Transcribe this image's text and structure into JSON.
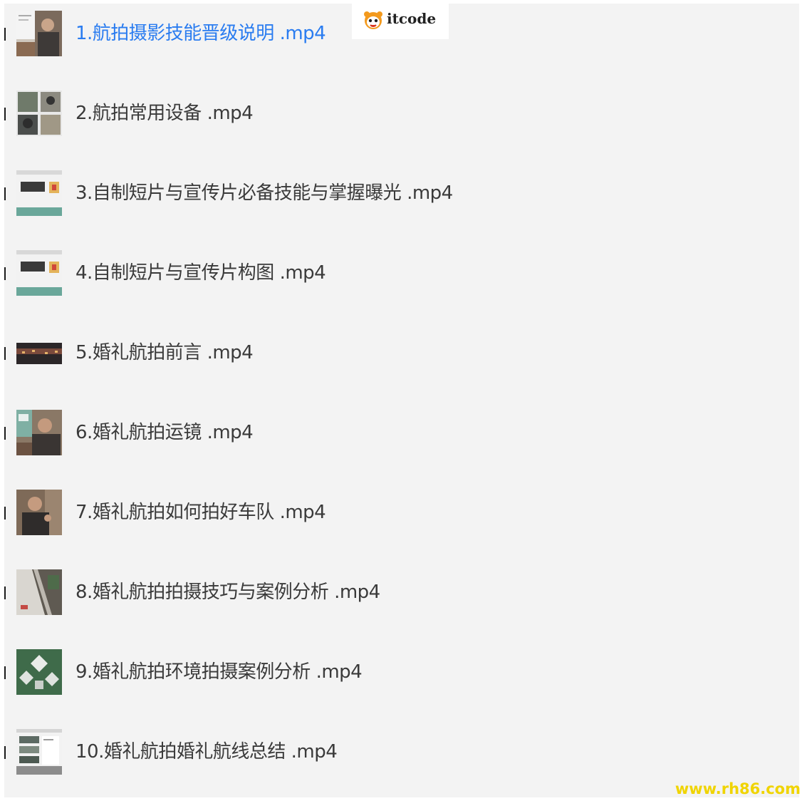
{
  "files": [
    {
      "name": "1.航拍摄影技能晋级说明 .mp4",
      "selected": true
    },
    {
      "name": "2.航拍常用设备 .mp4",
      "selected": false
    },
    {
      "name": "3.自制短片与宣传片必备技能与掌握曝光 .mp4",
      "selected": false
    },
    {
      "name": "4.自制短片与宣传片构图 .mp4",
      "selected": false
    },
    {
      "name": "5.婚礼航拍前言 .mp4",
      "selected": false
    },
    {
      "name": "6.婚礼航拍运镜 .mp4",
      "selected": false
    },
    {
      "name": "7.婚礼航拍如何拍好车队 .mp4",
      "selected": false
    },
    {
      "name": "8.婚礼航拍拍摄技巧与案例分析 .mp4",
      "selected": false
    },
    {
      "name": "9.婚礼航拍环境拍摄案例分析 .mp4",
      "selected": false
    },
    {
      "name": "10.婚礼航拍婚礼航线总结 .mp4",
      "selected": false
    }
  ],
  "badge": {
    "text": "itcode",
    "icon": "panda-icon"
  },
  "watermark": {
    "text": "www.rh86.com",
    "color": "#f0d400"
  },
  "colors": {
    "selected_text": "#2a7cf0",
    "text": "#3a3a3a",
    "background": "#f3f3f3"
  }
}
